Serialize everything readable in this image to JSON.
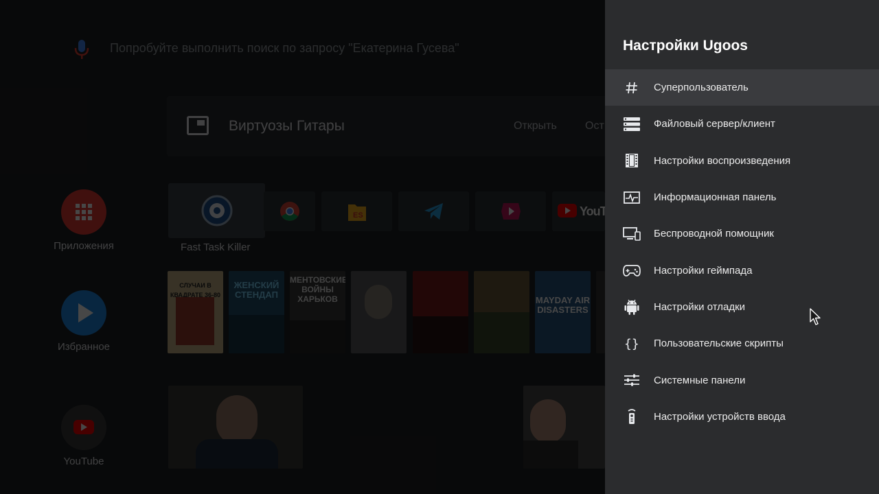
{
  "search": {
    "hint": "Попробуйте выполнить поиск по запросу \"Екатерина Гусева\""
  },
  "sidebar": {
    "items": [
      {
        "label": "Приложения",
        "icon": "apps-grid-icon",
        "color": "#e53935"
      },
      {
        "label": "Избранное",
        "icon": "play-icon",
        "color": "#1e88e5"
      },
      {
        "label": "YouTube",
        "icon": "youtube-icon",
        "color": "#3c3c3c"
      }
    ]
  },
  "banner": {
    "title": "Виртуозы Гитары",
    "actions": [
      "Открыть",
      "Ост"
    ]
  },
  "apps_row": {
    "focused_label": "Fast Task Killer",
    "tiles": [
      "fast-task-killer-icon",
      "chrome-icon",
      "es-file-explorer-icon",
      "telegram-icon",
      "video-player-icon",
      "youtube-icon"
    ],
    "youtube_text": "YouTu"
  },
  "posters": [
    {
      "text": "СЛУЧАИ В КВАДРАТЕ 36-80",
      "color": "#c9b38a"
    },
    {
      "text": "ЖЕНСКИЙ СТЕНДАП",
      "color": "#21506b"
    },
    {
      "text": "МЕНТОВСКИЕ ВОЙНЫ ХАРЬКОВ",
      "color": "#3a3a3a"
    },
    {
      "text": "",
      "color": "#5b5c5e"
    },
    {
      "text": "",
      "color": "#7a1c1c"
    },
    {
      "text": "",
      "color": "#6b5a3a"
    },
    {
      "text": "MAYDAY AIR DISASTERS",
      "color": "#2a5680"
    },
    {
      "text": "",
      "color": "#333"
    }
  ],
  "panel": {
    "title": "Настройки Ugoos",
    "items": [
      {
        "label": "Суперпользователь",
        "icon": "hash-icon",
        "selected": true
      },
      {
        "label": "Файловый сервер/клиент",
        "icon": "server-icon",
        "selected": false
      },
      {
        "label": "Настройки воспроизведения",
        "icon": "film-icon",
        "selected": false
      },
      {
        "label": "Информационная панель",
        "icon": "monitor-pulse-icon",
        "selected": false
      },
      {
        "label": "Беспроводной помощник",
        "icon": "devices-icon",
        "selected": false
      },
      {
        "label": "Настройки геймпада",
        "icon": "gamepad-icon",
        "selected": false
      },
      {
        "label": "Настройки отладки",
        "icon": "android-icon",
        "selected": false
      },
      {
        "label": "Пользовательские скрипты",
        "icon": "braces-icon",
        "selected": false
      },
      {
        "label": "Системные панели",
        "icon": "sliders-icon",
        "selected": false
      },
      {
        "label": "Настройки устройств ввода",
        "icon": "remote-icon",
        "selected": false
      }
    ]
  }
}
